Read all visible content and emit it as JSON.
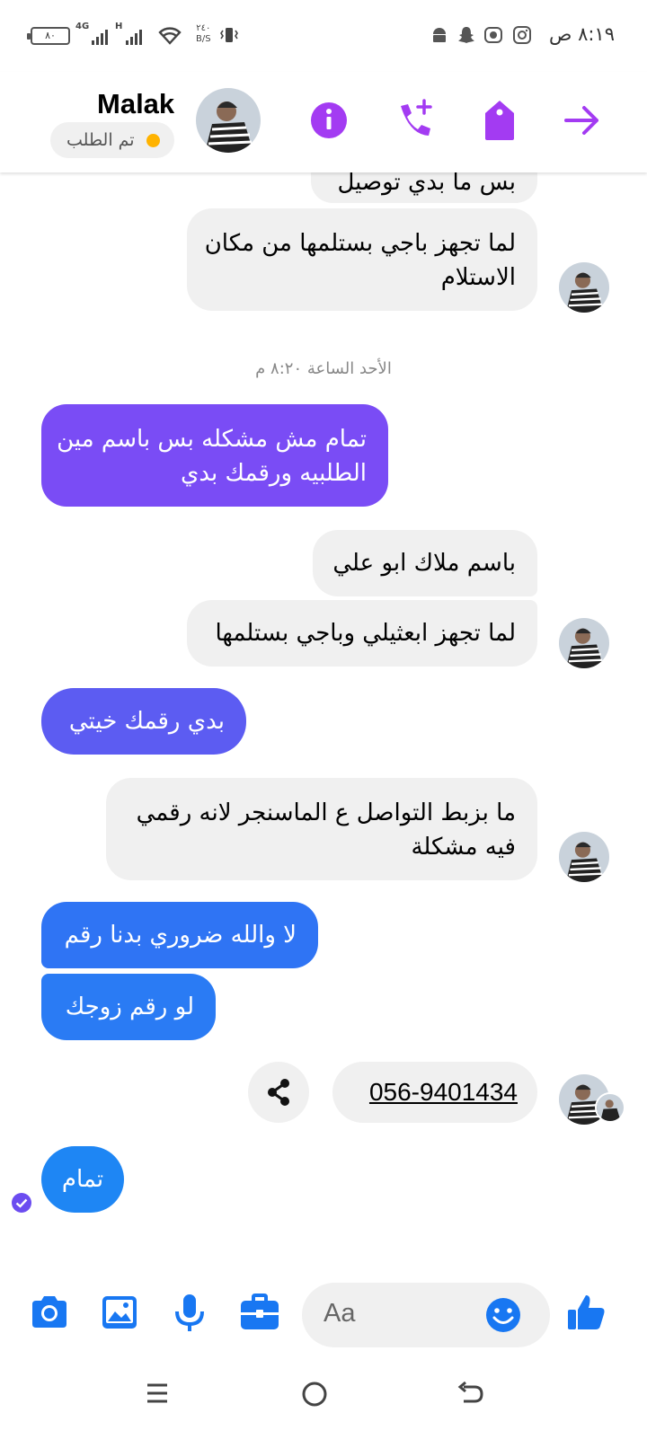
{
  "status_bar": {
    "time": "٨:١٩ ص",
    "battery": "٨٠",
    "network_1": "4G",
    "network_2": "H",
    "speed_value": "٢٤٠",
    "speed_unit": "B/S"
  },
  "header": {
    "contact_name": "Malak",
    "order_status": "تم الطلب",
    "status_dot_color": "#ffb300",
    "icons": [
      "info-icon",
      "add-call-icon",
      "tag-icon",
      "forward-arrow-icon"
    ],
    "accent_color": "#a33bf2"
  },
  "messages": [
    {
      "from": "contact",
      "text": "بس ما بدي توصيل"
    },
    {
      "from": "contact",
      "text_lines": [
        "لما تجهز باجي بستلمها من مكان",
        "الاستلام"
      ]
    },
    {
      "from": "me",
      "text_lines": [
        "تمام مش مشكله بس باسم مين",
        "الطلبيه ورقمك بدي"
      ],
      "color": "#7a4cf5"
    },
    {
      "from": "contact",
      "text": "باسم ملاك ابو علي"
    },
    {
      "from": "contact",
      "text": "لما تجهز ابعثيلي وباجي بستلمها"
    },
    {
      "from": "me",
      "text": "بدي رقمك خيتي",
      "color": "#5c5cf2"
    },
    {
      "from": "contact",
      "text_lines": [
        "ما بزبط التواصل ع الماسنجر لانه رقمي",
        "فيه مشكلة"
      ]
    },
    {
      "from": "me",
      "text": "لا والله ضروري بدنا رقم",
      "color": "#2f74f4"
    },
    {
      "from": "me",
      "text": "لو رقم زوجك",
      "color": "#2a7bf4"
    },
    {
      "from": "contact",
      "text": "056-9401434",
      "type": "phone-link"
    },
    {
      "from": "me",
      "text": "تمام",
      "color": "#1e86f4"
    }
  ],
  "timestamp": "الأحد الساعة ٨:٢٠ م",
  "composer": {
    "placeholder": "Aa",
    "buttons": [
      "camera-icon",
      "gallery-icon",
      "microphone-icon",
      "briefcase-icon",
      "emoji-icon",
      "thumbs-up-icon"
    ],
    "button_color": "#1877f2"
  },
  "nav_bar": [
    "menu-icon",
    "home-icon",
    "back-icon"
  ]
}
